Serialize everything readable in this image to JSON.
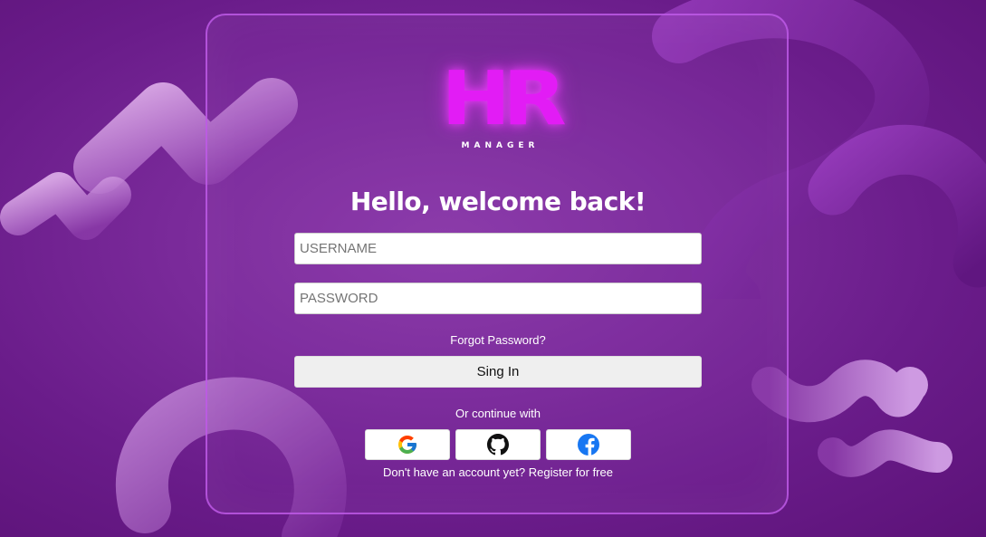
{
  "logo": {
    "mark": "HR",
    "subtitle": "MANAGER"
  },
  "heading": "Hello, welcome back!",
  "form": {
    "username_placeholder": "USERNAME",
    "password_placeholder": "PASSWORD",
    "forgot_label": "Forgot Password?",
    "signin_label": "Sing In",
    "continue_label": "Or continue with",
    "register_label": "Don't have an account yet? Register for free"
  },
  "social": [
    {
      "icon": "google-icon"
    },
    {
      "icon": "github-icon"
    },
    {
      "icon": "facebook-icon"
    }
  ],
  "colors": {
    "background": "#7a2a9a",
    "card_border": "#be5ae6",
    "logo_accent": "#e21cf5",
    "facebook_blue": "#1877f2"
  }
}
